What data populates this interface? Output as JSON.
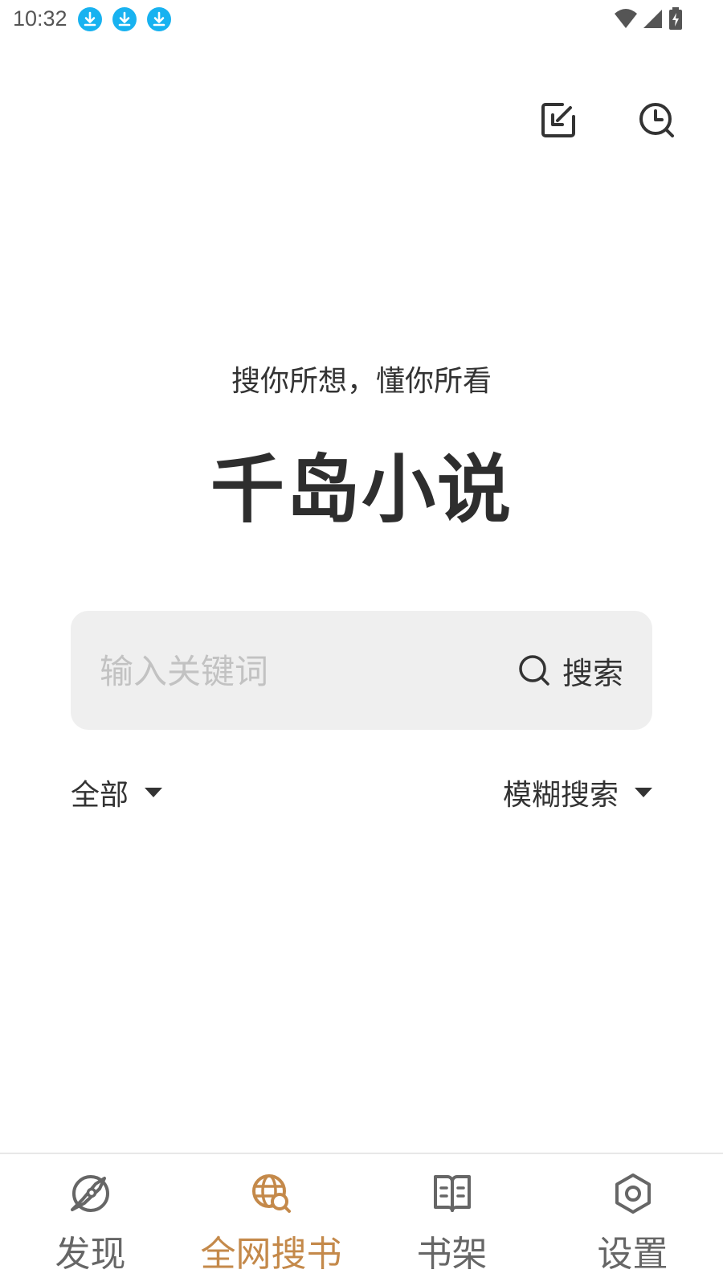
{
  "status_bar": {
    "time": "10:32",
    "notification_icons": [
      "download-icon",
      "download-icon",
      "download-icon"
    ],
    "right_icons": [
      "wifi-icon",
      "cellular-signal-icon",
      "battery-charging-icon"
    ]
  },
  "header": {
    "actions": [
      {
        "name": "import-icon"
      },
      {
        "name": "history-icon"
      }
    ]
  },
  "hero": {
    "slogan": "搜你所想，懂你所看",
    "title": "千岛小说"
  },
  "search": {
    "placeholder": "输入关键词",
    "value": "",
    "button_label": "搜索",
    "button_icon": "search-icon"
  },
  "filters": {
    "scope": "全部",
    "mode": "模糊搜索"
  },
  "bottom_nav": {
    "items": [
      {
        "label": "发现",
        "icon": "compass-icon",
        "active": false
      },
      {
        "label": "全网搜书",
        "icon": "globe-search-icon",
        "active": true
      },
      {
        "label": "书架",
        "icon": "book-icon",
        "active": false
      },
      {
        "label": "设置",
        "icon": "gear-icon",
        "active": false
      }
    ]
  },
  "colors": {
    "accent": "#c4894a",
    "inactive": "#666666",
    "search_bg": "#efefef",
    "download_badge": "#18b2f0"
  }
}
